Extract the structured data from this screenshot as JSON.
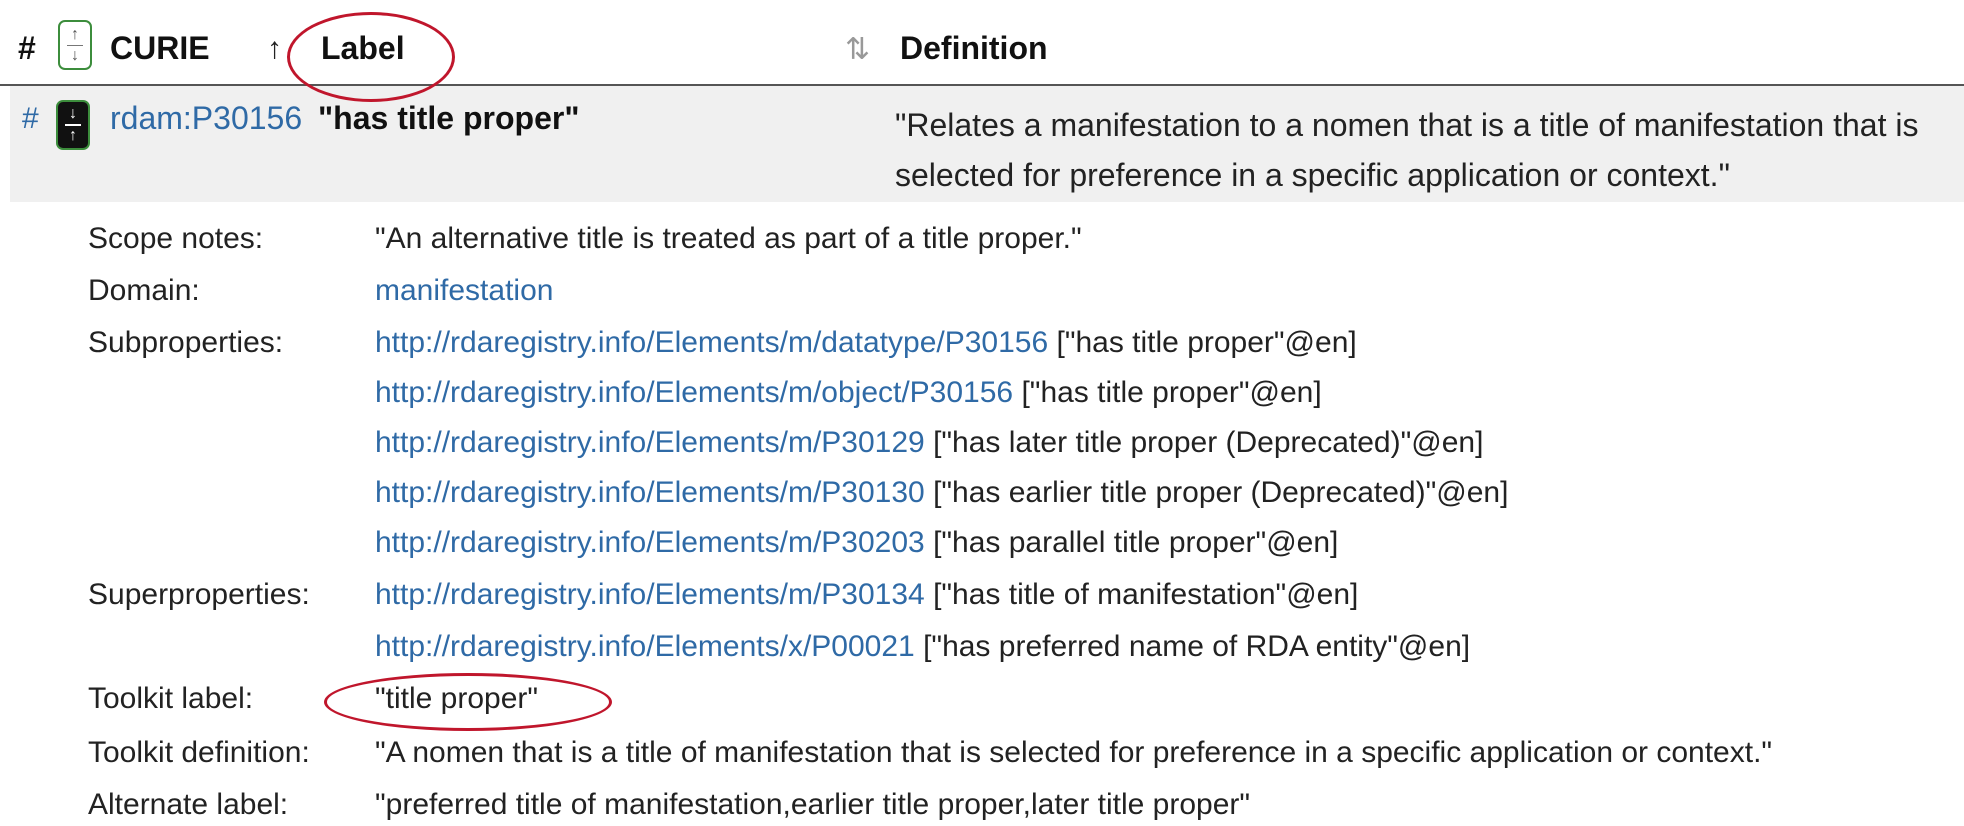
{
  "header": {
    "hash": "#",
    "curie": "CURIE",
    "curie_sort": "↑",
    "label": "Label",
    "label_sort": "⇅",
    "definition": "Definition"
  },
  "row": {
    "hash": "#",
    "curie": "rdam:P30156",
    "label": "\"has title proper\"",
    "definition": "\"Relates a manifestation to a nomen that is a title of manifestation that is selected for preference in a specific application or context.\""
  },
  "details": {
    "scope_notes_label": "Scope notes:",
    "scope_notes_value": "\"An alternative title is treated as part of a title proper.\"",
    "domain_label": "Domain:",
    "domain_value": "manifestation",
    "subproperties_label": "Subproperties:",
    "subproperties": [
      {
        "url": "http://rdaregistry.info/Elements/m/datatype/P30156",
        "text": "[\"has title proper\"@en]"
      },
      {
        "url": "http://rdaregistry.info/Elements/m/object/P30156",
        "text": "[\"has title proper\"@en]"
      },
      {
        "url": "http://rdaregistry.info/Elements/m/P30129",
        "text": "[\"has later title proper (Deprecated)\"@en]"
      },
      {
        "url": "http://rdaregistry.info/Elements/m/P30130",
        "text": "[\"has earlier title proper (Deprecated)\"@en]"
      },
      {
        "url": "http://rdaregistry.info/Elements/m/P30203",
        "text": "[\"has parallel title proper\"@en]"
      }
    ],
    "superproperties_label": "Superproperties:",
    "superproperties": [
      {
        "url": "http://rdaregistry.info/Elements/m/P30134",
        "text": "[\"has title of manifestation\"@en]"
      },
      {
        "url": "http://rdaregistry.info/Elements/x/P00021",
        "text": "[\"has preferred name of RDA entity\"@en]"
      }
    ],
    "toolkit_label_label": "Toolkit label:",
    "toolkit_label_value": "\"title proper\"",
    "toolkit_definition_label": "Toolkit definition:",
    "toolkit_definition_value": "\"A nomen that is a title of manifestation that is selected for preference in a specific application or context.\"",
    "alternate_label_label": "Alternate label:",
    "alternate_label_value": "\"preferred title of manifestation,earlier title proper,later title proper\""
  },
  "colors": {
    "link": "#2f6aa6",
    "annotation": "#c0162c",
    "row_bg": "#f0f0f0"
  }
}
